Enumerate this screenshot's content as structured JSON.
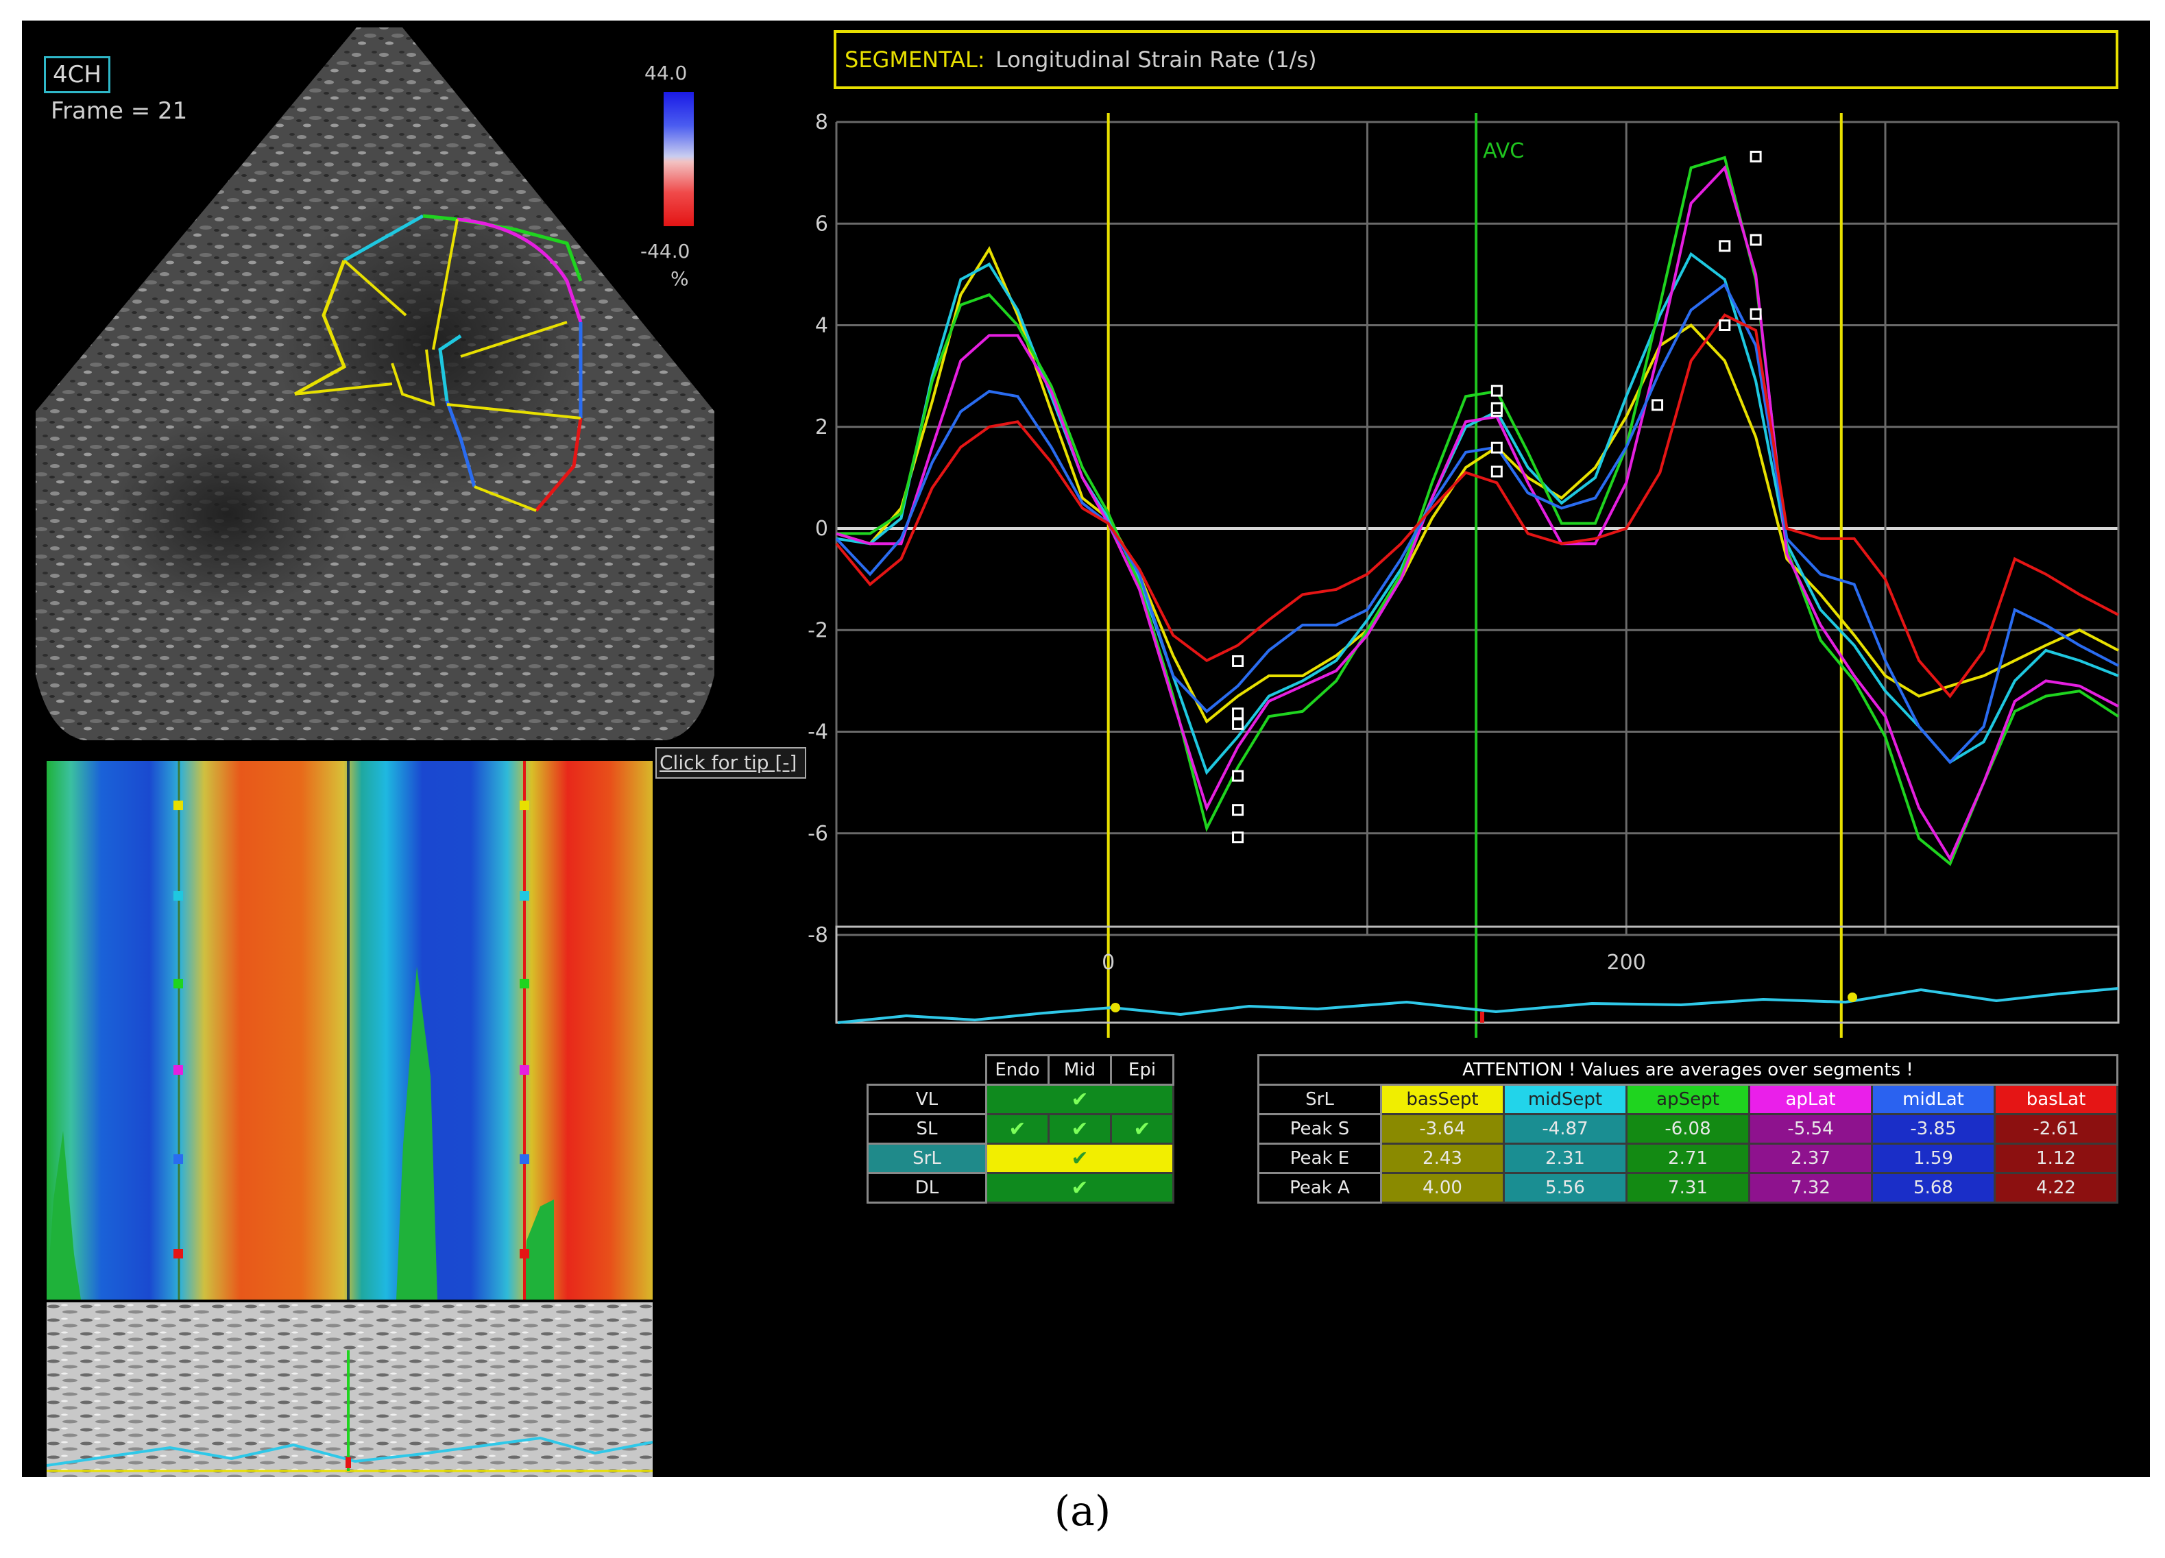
{
  "caption": "(a)",
  "view_badge": "4CH",
  "frame_label": "Frame = 21",
  "color_scale": {
    "max_label": "44.0",
    "min_label": "-44.0",
    "unit": "%"
  },
  "tooltip_button": "Click for tip [-]",
  "chart_title": {
    "prefix": "SEGMENTAL:",
    "text": "Longitudinal Strain Rate (1/s)"
  },
  "chart_data": {
    "type": "line",
    "title": "SEGMENTAL: Longitudinal Strain Rate (1/s)",
    "xlim": [
      -105,
      390
    ],
    "ylim": [
      -8,
      8
    ],
    "xticks": [
      "0",
      "200"
    ],
    "yticks": [
      "8",
      "6",
      "4",
      "2",
      "0",
      "-2",
      "-4",
      "-6",
      "-8"
    ],
    "grid": true,
    "vertical_markers": [
      {
        "x": 0,
        "label": "",
        "color": "#e8e000"
      },
      {
        "x": 142,
        "label": "AVC",
        "color": "#1fc41f"
      },
      {
        "x": 283,
        "label": "",
        "color": "#e8e000"
      }
    ],
    "x": [
      -105,
      -92,
      -80,
      -68,
      -57,
      -46,
      -35,
      -22,
      -10,
      0,
      12,
      25,
      38,
      50,
      62,
      75,
      88,
      100,
      113,
      125,
      138,
      150,
      162,
      175,
      188,
      200,
      213,
      225,
      238,
      250,
      262,
      275,
      288,
      300,
      313,
      325,
      338,
      350,
      362,
      375,
      390
    ],
    "series": [
      {
        "name": "basSept",
        "color": "#e8e000",
        "values": [
          -0.1,
          -0.3,
          0.4,
          2.5,
          4.6,
          5.5,
          4.2,
          2.3,
          0.6,
          0.2,
          -0.9,
          -2.5,
          -3.8,
          -3.3,
          -2.9,
          -2.9,
          -2.5,
          -2.0,
          -1.0,
          0.2,
          1.2,
          1.6,
          1.0,
          0.6,
          1.2,
          2.2,
          3.6,
          4.0,
          3.3,
          1.8,
          -0.6,
          -1.3,
          -2.1,
          -2.9,
          -3.3,
          -3.1,
          -2.9,
          -2.6,
          -2.3,
          -2.0,
          -2.4
        ]
      },
      {
        "name": "midSept",
        "color": "#1fc8e0",
        "values": [
          -0.2,
          -0.3,
          0.2,
          3.0,
          4.9,
          5.2,
          4.3,
          2.6,
          1.0,
          0.2,
          -1.0,
          -2.9,
          -4.8,
          -4.1,
          -3.3,
          -3.0,
          -2.6,
          -1.8,
          -0.8,
          0.6,
          2.0,
          2.3,
          1.2,
          0.5,
          1.0,
          2.6,
          4.2,
          5.4,
          4.9,
          2.9,
          -0.3,
          -1.6,
          -2.3,
          -3.2,
          -3.9,
          -4.6,
          -4.2,
          -3.0,
          -2.4,
          -2.6,
          -2.9
        ]
      },
      {
        "name": "apSept",
        "color": "#1fd41f",
        "values": [
          -0.1,
          -0.1,
          0.3,
          2.9,
          4.4,
          4.6,
          4.0,
          2.8,
          1.2,
          0.3,
          -1.1,
          -3.3,
          -5.9,
          -4.7,
          -3.7,
          -3.6,
          -3.0,
          -2.0,
          -0.9,
          0.9,
          2.6,
          2.7,
          1.5,
          0.1,
          0.1,
          1.6,
          4.4,
          7.1,
          7.3,
          4.9,
          -0.4,
          -2.2,
          -3.0,
          -4.1,
          -6.1,
          -6.6,
          -5.0,
          -3.6,
          -3.3,
          -3.2,
          -3.7
        ]
      },
      {
        "name": "apLat",
        "color": "#e51fe0",
        "values": [
          -0.1,
          -0.3,
          -0.3,
          1.6,
          3.3,
          3.8,
          3.8,
          2.7,
          1.0,
          0.1,
          -1.2,
          -3.4,
          -5.5,
          -4.3,
          -3.4,
          -3.1,
          -2.8,
          -2.1,
          -1.0,
          0.6,
          2.1,
          2.2,
          0.9,
          -0.3,
          -0.3,
          0.9,
          3.6,
          6.4,
          7.1,
          5.0,
          -0.5,
          -1.9,
          -2.9,
          -3.7,
          -5.5,
          -6.5,
          -5.0,
          -3.4,
          -3.0,
          -3.1,
          -3.5
        ]
      },
      {
        "name": "midLat",
        "color": "#2a6cf0",
        "values": [
          -0.2,
          -0.9,
          -0.2,
          1.3,
          2.3,
          2.7,
          2.6,
          1.6,
          0.5,
          0.1,
          -0.9,
          -2.9,
          -3.6,
          -3.1,
          -2.4,
          -1.9,
          -1.9,
          -1.6,
          -0.6,
          0.5,
          1.5,
          1.6,
          0.7,
          0.4,
          0.6,
          1.6,
          3.1,
          4.3,
          4.8,
          3.6,
          -0.2,
          -0.9,
          -1.1,
          -2.6,
          -3.9,
          -4.6,
          -3.9,
          -1.6,
          -1.9,
          -2.3,
          -2.7
        ]
      },
      {
        "name": "basLat",
        "color": "#e51515",
        "values": [
          -0.3,
          -1.1,
          -0.6,
          0.8,
          1.6,
          2.0,
          2.1,
          1.3,
          0.4,
          0.1,
          -0.8,
          -2.1,
          -2.6,
          -2.3,
          -1.8,
          -1.3,
          -1.2,
          -0.9,
          -0.3,
          0.4,
          1.1,
          0.9,
          -0.1,
          -0.3,
          -0.2,
          0.0,
          1.1,
          3.3,
          4.2,
          3.9,
          0.0,
          -0.2,
          -0.2,
          -1.0,
          -2.6,
          -3.3,
          -2.4,
          -0.6,
          -0.9,
          -1.3,
          -1.7
        ]
      }
    ],
    "peak_markers": [
      {
        "x": 50,
        "y": -2.61
      },
      {
        "x": 50,
        "y": -3.64
      },
      {
        "x": 50,
        "y": -3.85
      },
      {
        "x": 50,
        "y": -4.87
      },
      {
        "x": 50,
        "y": -5.54
      },
      {
        "x": 50,
        "y": -6.08
      },
      {
        "x": 150,
        "y": 1.12
      },
      {
        "x": 150,
        "y": 1.59
      },
      {
        "x": 150,
        "y": 2.31
      },
      {
        "x": 150,
        "y": 2.37
      },
      {
        "x": 150,
        "y": 2.71
      },
      {
        "x": 212,
        "y": 2.43
      },
      {
        "x": 238,
        "y": 4.0
      },
      {
        "x": 238,
        "y": 5.56
      },
      {
        "x": 250,
        "y": 5.68
      },
      {
        "x": 250,
        "y": 7.32
      },
      {
        "x": 250,
        "y": 4.22
      }
    ]
  },
  "layer_table": {
    "headers": [
      "Endo",
      "Mid",
      "Epi"
    ],
    "rows": [
      {
        "label": "VL",
        "check": "✔"
      },
      {
        "label": "SL",
        "check": "✔"
      },
      {
        "label": "SrL",
        "check": "✔"
      },
      {
        "label": "DL",
        "check": "✔"
      }
    ]
  },
  "peak_table": {
    "attention": "ATTENTION !  Values are averages over segments !",
    "header_label": "SrL",
    "segments": [
      {
        "name": "basSept",
        "color": "#f0ee00",
        "text": "#222222",
        "cell": "#8a8a00"
      },
      {
        "name": "midSept",
        "color": "#22d4ea",
        "text": "#222222",
        "cell": "#1a8e92"
      },
      {
        "name": "apSept",
        "color": "#1fd41f",
        "text": "#222222",
        "cell": "#138a13"
      },
      {
        "name": "apLat",
        "color": "#ea1fea",
        "text": "#ffffff",
        "cell": "#8e128e"
      },
      {
        "name": "midLat",
        "color": "#2a62f0",
        "text": "#ffffff",
        "cell": "#1a2ec8"
      },
      {
        "name": "basLat",
        "color": "#e51515",
        "text": "#ffffff",
        "cell": "#8c1010"
      }
    ],
    "rows": [
      {
        "label": "Peak S",
        "values": [
          "-3.64",
          "-4.87",
          "-6.08",
          "-5.54",
          "-3.85",
          "-2.61"
        ]
      },
      {
        "label": "Peak E",
        "values": [
          "2.43",
          "2.31",
          "2.71",
          "2.37",
          "1.59",
          "1.12"
        ]
      },
      {
        "label": "Peak A",
        "values": [
          "4.00",
          "5.56",
          "7.31",
          "7.32",
          "5.68",
          "4.22"
        ]
      }
    ]
  },
  "icons": [
    "check-icon"
  ]
}
